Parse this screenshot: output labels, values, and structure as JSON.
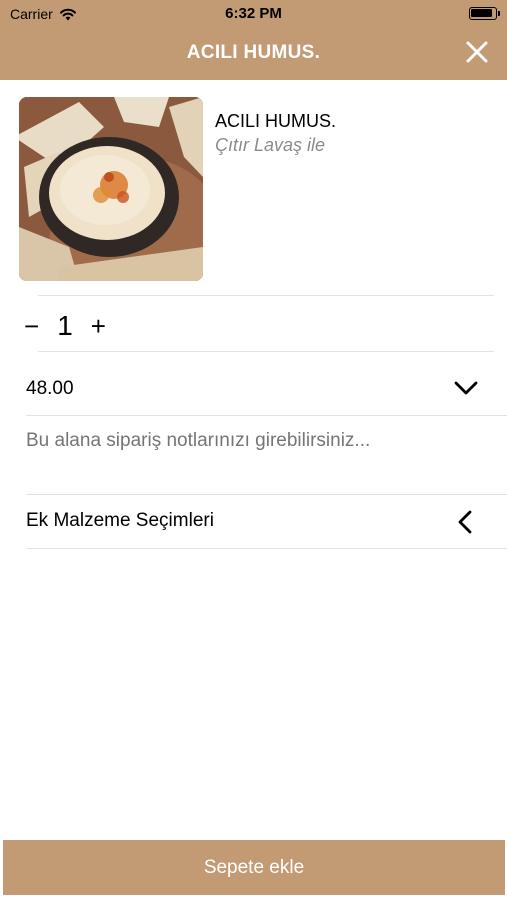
{
  "status_bar": {
    "carrier": "Carrier",
    "time": "6:32 PM"
  },
  "header": {
    "title": "ACILI HUMUS.",
    "close_icon": "close-icon"
  },
  "product": {
    "name": "ACILI HUMUS.",
    "description": "Çıtır Lavaş ile",
    "image_icon": "hummus-dish-photo"
  },
  "quantity": {
    "minus": "−",
    "value": "1",
    "plus": "+"
  },
  "price": {
    "value": "48.00",
    "icon": "chevron-down-icon"
  },
  "notes": {
    "placeholder": "Bu alana sipariş notlarınızı girebilirsiniz..."
  },
  "extras": {
    "label": "Ek Malzeme Seçimleri",
    "icon": "chevron-left-icon"
  },
  "footer": {
    "add_to_cart": "Sepete ekle"
  },
  "colors": {
    "accent": "#c29a74",
    "divider": "#e2e2e2",
    "muted_text": "#8e8e8e"
  }
}
